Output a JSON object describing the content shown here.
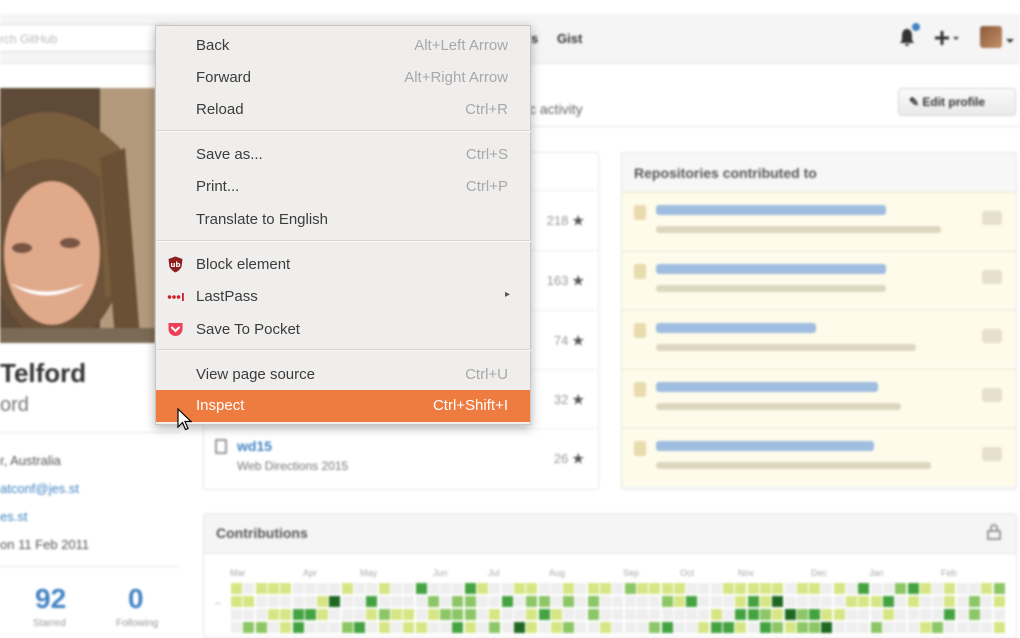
{
  "header": {
    "search_placeholder": "rch GitHub",
    "nav_visible": [
      "s",
      "Gist"
    ],
    "icons": [
      "bell-icon",
      "plus-icon",
      "avatar"
    ]
  },
  "profile": {
    "tab_partial": "blic activity",
    "edit_label": "Edit profile",
    "name": "Telford",
    "username": "ord",
    "location": "r, Australia",
    "email": "atconf@jes.st",
    "website": "es.st",
    "joined": "on 11 Feb 2011",
    "stats": [
      {
        "num": "92",
        "label": "Starred"
      },
      {
        "num": "0",
        "label": "Following"
      }
    ]
  },
  "repositories": [
    {
      "stars": "218"
    },
    {
      "stars": "163"
    },
    {
      "stars": "74"
    },
    {
      "stars": "32"
    },
    {
      "name": "wd15",
      "description": "Web Directions 2015",
      "stars": "26"
    }
  ],
  "contributed": {
    "title": "Repositories contributed to"
  },
  "contributions": {
    "title": "Contributions",
    "months": [
      "Mar",
      "Apr",
      "May",
      "Jun",
      "Jul",
      "Aug",
      "Sep",
      "Oct",
      "Nov",
      "Dec",
      "Jan",
      "Feb"
    ],
    "colors": [
      "#eeeeee",
      "#d6e685",
      "#8cc665",
      "#44a340",
      "#1e6823"
    ]
  },
  "context_menu": {
    "accent": "#ee7c41",
    "groups": [
      [
        {
          "label": "Back",
          "shortcut": "Alt+Left Arrow"
        },
        {
          "label": "Forward",
          "shortcut": "Alt+Right Arrow"
        },
        {
          "label": "Reload",
          "shortcut": "Ctrl+R"
        }
      ],
      [
        {
          "label": "Save as...",
          "shortcut": "Ctrl+S"
        },
        {
          "label": "Print...",
          "shortcut": "Ctrl+P"
        },
        {
          "label": "Translate to English",
          "shortcut": ""
        }
      ],
      [
        {
          "label": "Block element",
          "shortcut": "",
          "icon": "ublock-icon"
        },
        {
          "label": "LastPass",
          "shortcut": "",
          "icon": "lastpass-icon",
          "submenu": "▸"
        },
        {
          "label": "Save To Pocket",
          "shortcut": "",
          "icon": "pocket-icon"
        }
      ],
      [
        {
          "label": "View page source",
          "shortcut": "Ctrl+U"
        },
        {
          "label": "Inspect",
          "shortcut": "Ctrl+Shift+I",
          "highlighted": true
        }
      ]
    ]
  }
}
